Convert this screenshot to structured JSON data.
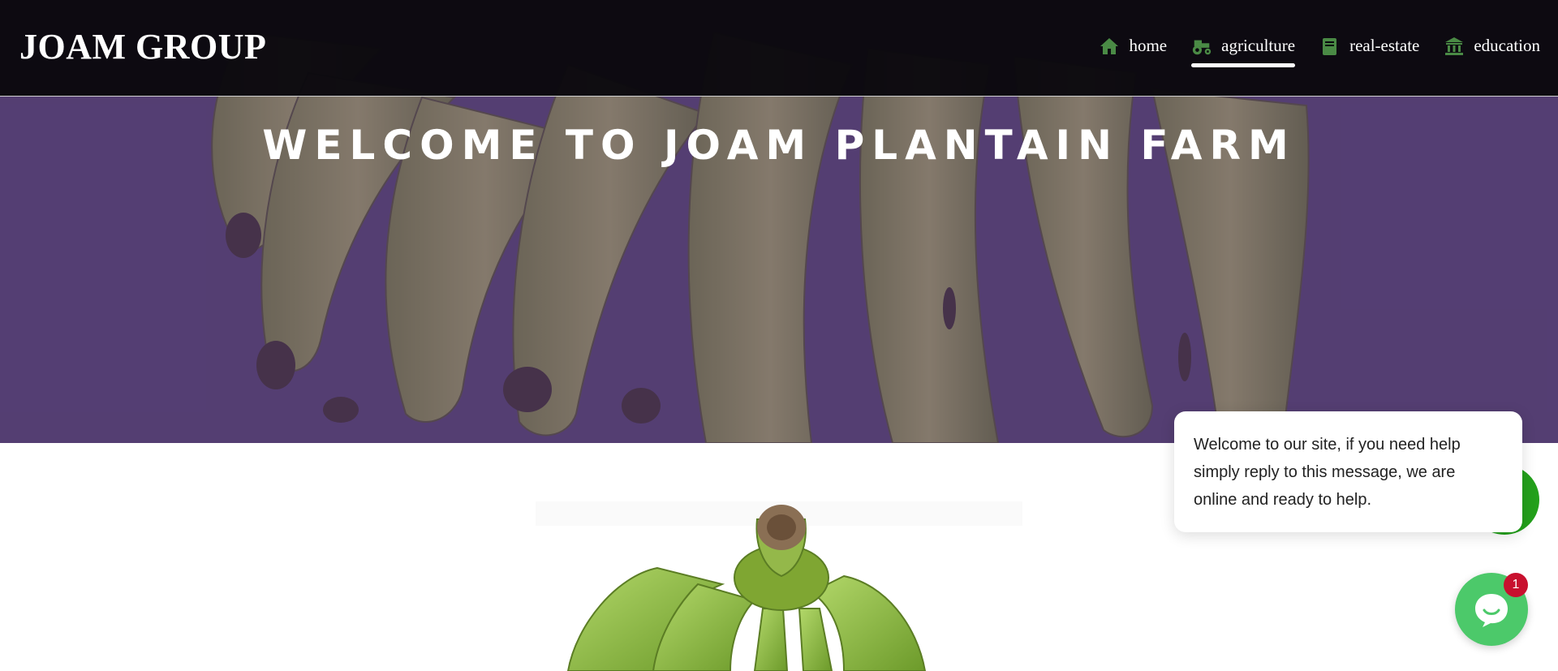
{
  "header": {
    "brand": "JOAM GROUP",
    "nav": [
      {
        "label": "home",
        "icon": "home-icon",
        "active": false
      },
      {
        "label": "agriculture",
        "icon": "tractor-icon",
        "active": true
      },
      {
        "label": "real-estate",
        "icon": "book-icon",
        "active": false
      },
      {
        "label": "education",
        "icon": "bank-icon",
        "active": false
      }
    ],
    "icon_color": "#4a8a45"
  },
  "hero": {
    "title": "WELCOME TO JOAM PLANTAIN FARM",
    "overlay_color": "#4e386e"
  },
  "chat": {
    "message": "Welcome to our site, if you need help simply reply to this message, we are online and ready to help.",
    "unread_count": "1",
    "launcher_color": "#4cc96a",
    "whatsapp_color": "#23a01b"
  }
}
